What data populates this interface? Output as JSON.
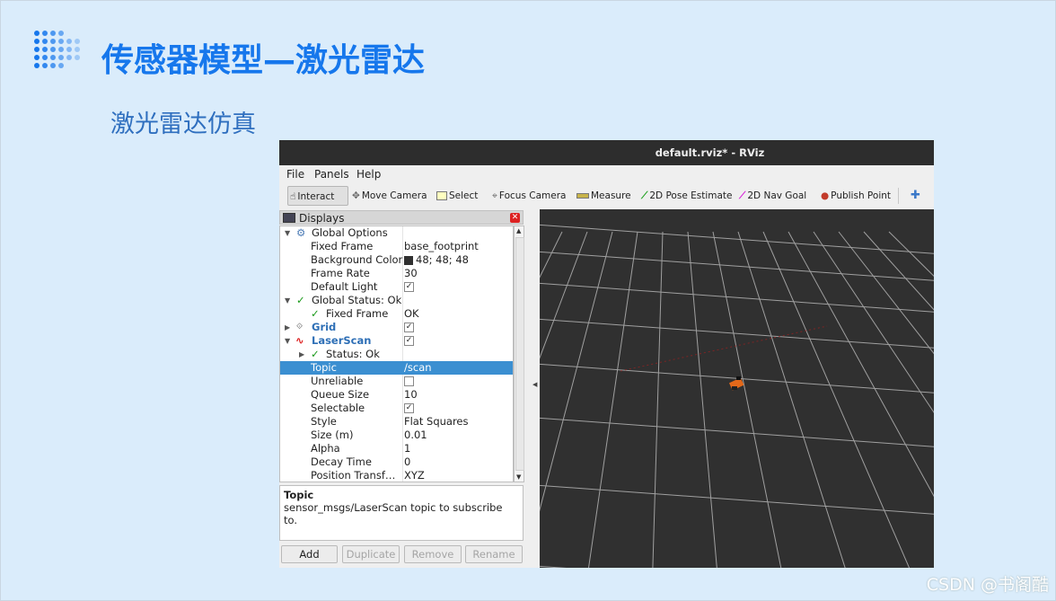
{
  "slide": {
    "title": "传感器模型—激光雷达",
    "subtitle": "激光雷达仿真",
    "watermark": "CSDN @书阁酷"
  },
  "colors": {
    "slide_bg": "#daecfb",
    "title": "#1677ec",
    "selection": "#3b8fd1",
    "viewport_bg": "#303030",
    "grid_line": "#a0a0a0",
    "robot": "#e2681a"
  },
  "window": {
    "title": "default.rviz* - RViz"
  },
  "menu": [
    "File",
    "Panels",
    "Help"
  ],
  "toolbar": [
    {
      "label": "Interact",
      "icon": "hand-pointer-icon"
    },
    {
      "label": "Move Camera",
      "icon": "move-arrows-icon"
    },
    {
      "label": "Select",
      "icon": "select-box-icon"
    },
    {
      "label": "Focus Camera",
      "icon": "crosshair-icon"
    },
    {
      "label": "Measure",
      "icon": "ruler-icon"
    },
    {
      "label": "2D Pose Estimate",
      "icon": "green-arrow-icon"
    },
    {
      "label": "2D Nav Goal",
      "icon": "magenta-arrow-icon"
    },
    {
      "label": "Publish Point",
      "icon": "map-pin-icon"
    },
    {
      "label": "",
      "icon": "plus-icon"
    }
  ],
  "displays": {
    "header": "Displays",
    "rows": [
      {
        "key": "Global Options",
        "value": ""
      },
      {
        "key": "Fixed Frame",
        "value": "base_footprint"
      },
      {
        "key": "Background Color",
        "value": "48; 48; 48"
      },
      {
        "key": "Frame Rate",
        "value": "30"
      },
      {
        "key": "Default Light",
        "value": ""
      },
      {
        "key": "Global Status: Ok",
        "value": ""
      },
      {
        "key": "Fixed Frame",
        "value": "OK"
      },
      {
        "key": "Grid",
        "value": ""
      },
      {
        "key": "LaserScan",
        "value": ""
      },
      {
        "key": "Status: Ok",
        "value": ""
      },
      {
        "key": "Topic",
        "value": "/scan"
      },
      {
        "key": "Unreliable",
        "value": ""
      },
      {
        "key": "Queue Size",
        "value": "10"
      },
      {
        "key": "Selectable",
        "value": ""
      },
      {
        "key": "Style",
        "value": "Flat Squares"
      },
      {
        "key": "Size (m)",
        "value": "0.01"
      },
      {
        "key": "Alpha",
        "value": "1"
      },
      {
        "key": "Decay Time",
        "value": "0"
      },
      {
        "key": "Position Transf…",
        "value": "XYZ"
      }
    ],
    "description_title": "Topic",
    "description_text": "sensor_msgs/LaserScan topic to subscribe to."
  },
  "buttons": [
    "Add",
    "Duplicate",
    "Remove",
    "Rename"
  ]
}
